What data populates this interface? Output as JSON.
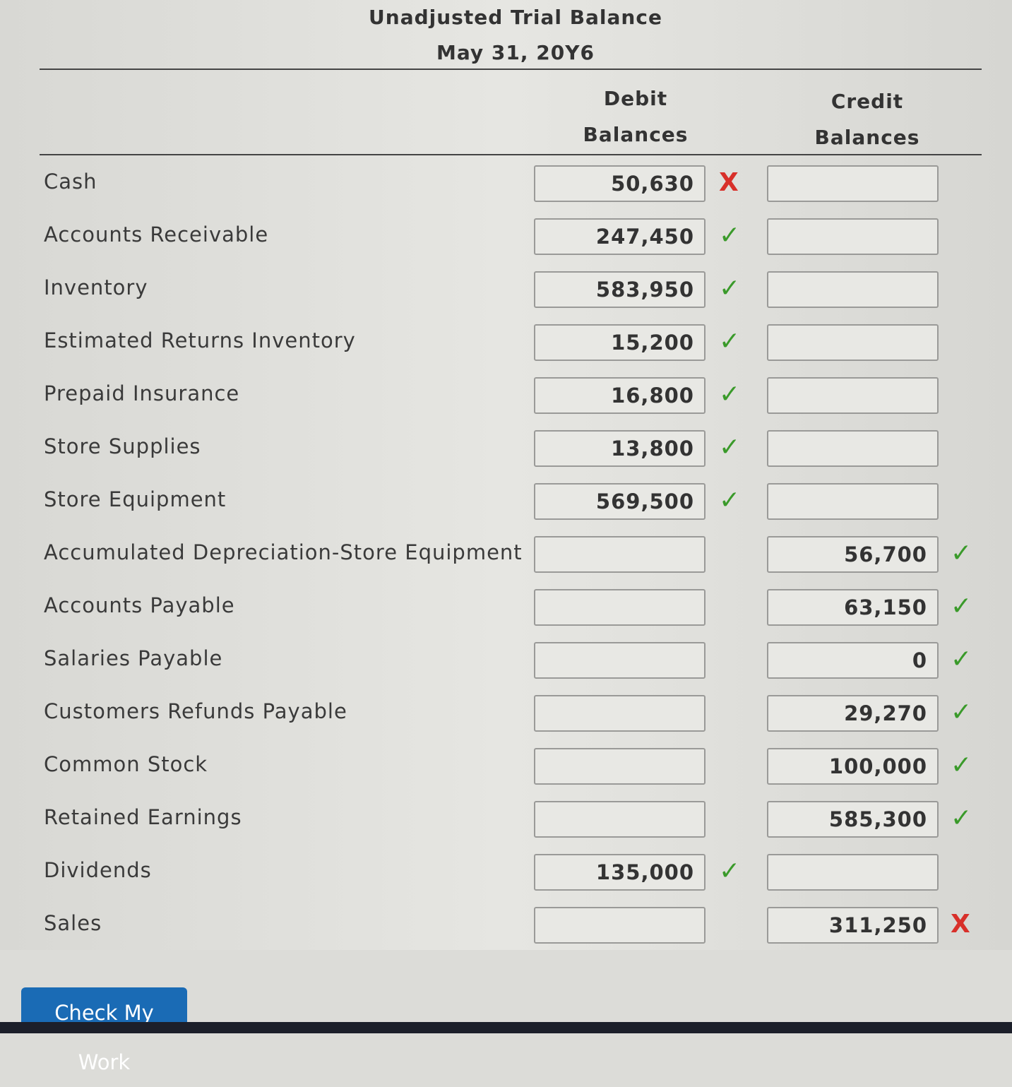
{
  "header": {
    "title": "Unadjusted Trial Balance",
    "date": "May 31, 20Y6"
  },
  "columns": {
    "debit": [
      "Debit",
      "Balances"
    ],
    "credit": [
      "Credit",
      "Balances"
    ]
  },
  "rows": [
    {
      "label": "Cash",
      "debit": "50,630",
      "credit": "",
      "mark": "x",
      "side": "debit"
    },
    {
      "label": "Accounts Receivable",
      "debit": "247,450",
      "credit": "",
      "mark": "check",
      "side": "debit"
    },
    {
      "label": "Inventory",
      "debit": "583,950",
      "credit": "",
      "mark": "check",
      "side": "debit"
    },
    {
      "label": "Estimated Returns Inventory",
      "debit": "15,200",
      "credit": "",
      "mark": "check",
      "side": "debit"
    },
    {
      "label": "Prepaid Insurance",
      "debit": "16,800",
      "credit": "",
      "mark": "check",
      "side": "debit"
    },
    {
      "label": "Store Supplies",
      "debit": "13,800",
      "credit": "",
      "mark": "check",
      "side": "debit"
    },
    {
      "label": "Store Equipment",
      "debit": "569,500",
      "credit": "",
      "mark": "check",
      "side": "debit"
    },
    {
      "label": "Accumulated Depreciation-Store Equipment",
      "debit": "",
      "credit": "56,700",
      "mark": "check",
      "side": "credit"
    },
    {
      "label": "Accounts Payable",
      "debit": "",
      "credit": "63,150",
      "mark": "check",
      "side": "credit"
    },
    {
      "label": "Salaries Payable",
      "debit": "",
      "credit": "0",
      "mark": "check",
      "side": "credit"
    },
    {
      "label": "Customers Refunds Payable",
      "debit": "",
      "credit": "29,270",
      "mark": "check",
      "side": "credit"
    },
    {
      "label": "Common Stock",
      "debit": "",
      "credit": "100,000",
      "mark": "check",
      "side": "credit"
    },
    {
      "label": "Retained Earnings",
      "debit": "",
      "credit": "585,300",
      "mark": "check",
      "side": "credit"
    },
    {
      "label": "Dividends",
      "debit": "135,000",
      "credit": "",
      "mark": "check",
      "side": "debit"
    },
    {
      "label": "Sales",
      "debit": "",
      "credit": "311,250",
      "mark": "x",
      "side": "credit"
    }
  ],
  "marks": {
    "check": "✓",
    "x": "X"
  },
  "colors": {
    "correct": "#3a9a2a",
    "incorrect": "#d8302a",
    "button": "#1a6bb5"
  },
  "footer": {
    "check_button": "Check My Work"
  }
}
